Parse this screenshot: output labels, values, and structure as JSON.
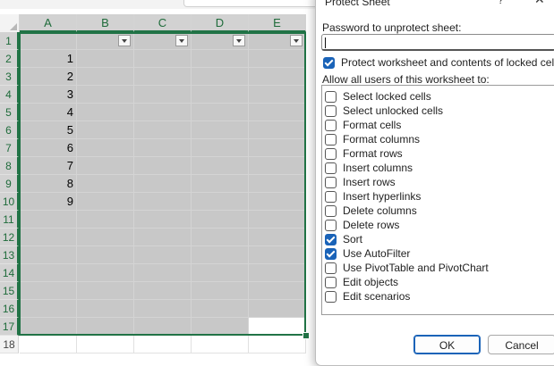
{
  "sheet": {
    "columns": [
      "A",
      "B",
      "C",
      "D",
      "E"
    ],
    "rows": [
      "1",
      "2",
      "3",
      "4",
      "5",
      "6",
      "7",
      "8",
      "9",
      "10",
      "11",
      "12",
      "13",
      "14",
      "15",
      "16",
      "17",
      "18"
    ],
    "values_col_a": [
      "",
      "1",
      "2",
      "3",
      "4",
      "5",
      "6",
      "7",
      "8",
      "9",
      "",
      "",
      "",
      "",
      "",
      "",
      "",
      ""
    ],
    "filter_row": 1,
    "sorted_column": "A"
  },
  "dialog": {
    "title": "Protect Sheet",
    "help": "?",
    "close": "✕",
    "password_label": "Password to unprotect sheet:",
    "password_value": "",
    "protect_label": "Protect worksheet and contents of locked cells",
    "protect_checked": true,
    "allow_label": "Allow all users of this worksheet to:",
    "permissions": [
      {
        "label": "Select locked cells",
        "checked": false
      },
      {
        "label": "Select unlocked cells",
        "checked": false
      },
      {
        "label": "Format cells",
        "checked": false
      },
      {
        "label": "Format columns",
        "checked": false
      },
      {
        "label": "Format rows",
        "checked": false
      },
      {
        "label": "Insert columns",
        "checked": false
      },
      {
        "label": "Insert rows",
        "checked": false
      },
      {
        "label": "Insert hyperlinks",
        "checked": false
      },
      {
        "label": "Delete columns",
        "checked": false
      },
      {
        "label": "Delete rows",
        "checked": false
      },
      {
        "label": "Sort",
        "checked": true
      },
      {
        "label": "Use AutoFilter",
        "checked": true
      },
      {
        "label": "Use PivotTable and PivotChart",
        "checked": false
      },
      {
        "label": "Edit objects",
        "checked": false
      },
      {
        "label": "Edit scenarios",
        "checked": false
      }
    ],
    "ok_label": "OK",
    "cancel_label": "Cancel"
  },
  "colors": {
    "accent_green": "#217346",
    "check_blue": "#1a63b8",
    "selection_gray": "#c8c8c8"
  }
}
